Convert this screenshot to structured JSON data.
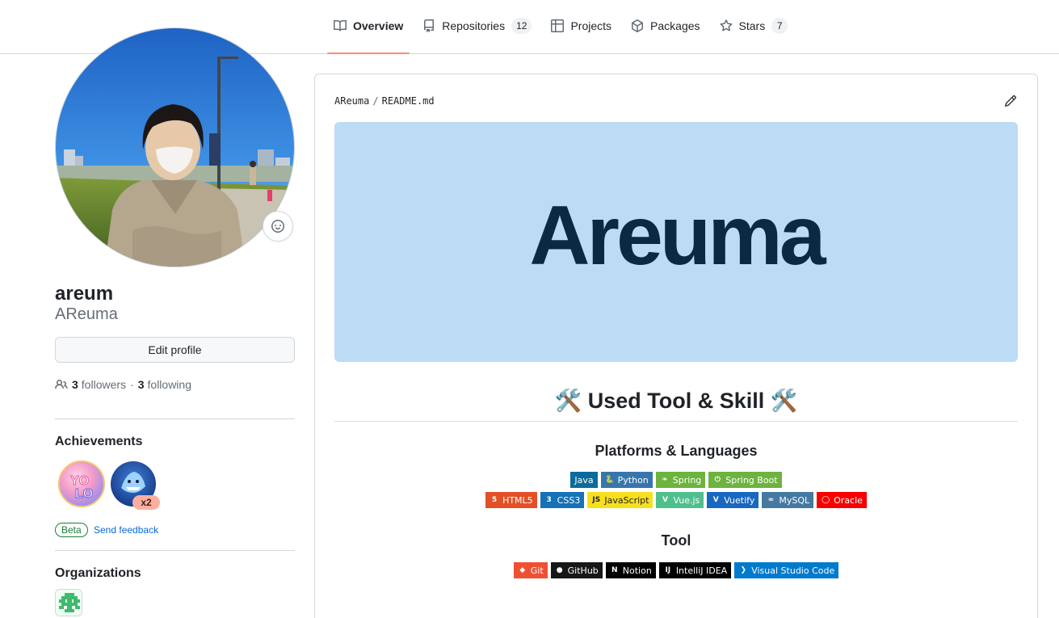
{
  "tabs": [
    {
      "label": "Overview",
      "icon": "book-icon",
      "active": true
    },
    {
      "label": "Repositories",
      "icon": "repo-icon",
      "count": "12"
    },
    {
      "label": "Projects",
      "icon": "table-icon"
    },
    {
      "label": "Packages",
      "icon": "package-icon"
    },
    {
      "label": "Stars",
      "icon": "star-icon",
      "count": "7"
    }
  ],
  "profile": {
    "name": "areum",
    "login": "AReuma",
    "edit_label": "Edit profile",
    "followers_count": "3",
    "followers_label": "followers",
    "following_count": "3",
    "following_label": "following",
    "separator": "·"
  },
  "achievements": {
    "title": "Achievements",
    "items": [
      {
        "icon": "yolo-badge-icon"
      },
      {
        "icon": "pull-shark-badge-icon",
        "count": "x2"
      }
    ],
    "beta_label": "Beta",
    "feedback_label": "Send feedback"
  },
  "organizations": {
    "title": "Organizations"
  },
  "readme": {
    "owner": "AReuma",
    "separator": "/",
    "file": "README.md",
    "banner_text": "Areuma",
    "heading": "🛠️ Used Tool & Skill 🛠️",
    "sections": [
      {
        "title": "Platforms & Languages",
        "rows": [
          [
            {
              "label": "Java",
              "bg": "#0a6c9b",
              "icon": ""
            },
            {
              "label": "Python",
              "bg": "#3776ab",
              "icon": "python"
            },
            {
              "label": "Spring",
              "bg": "#6db33f",
              "icon": "spring"
            },
            {
              "label": "Spring Boot",
              "bg": "#6db33f",
              "icon": "springboot"
            }
          ],
          [
            {
              "label": "HTML5",
              "bg": "#e34f26",
              "icon": "html5"
            },
            {
              "label": "CSS3",
              "bg": "#1572b6",
              "icon": "css3"
            },
            {
              "label": "JavaScript",
              "bg": "#f7df1e",
              "icon": "js",
              "dark": true
            },
            {
              "label": "Vue.js",
              "bg": "#4fc08d",
              "icon": "vue"
            },
            {
              "label": "Vuetify",
              "bg": "#1867c0",
              "icon": "vuetify"
            },
            {
              "label": "MySQL",
              "bg": "#4479a1",
              "icon": "mysql"
            },
            {
              "label": "Oracle",
              "bg": "#f80000",
              "icon": "oracle"
            }
          ]
        ]
      },
      {
        "title": "Tool",
        "rows": [
          [
            {
              "label": "Git",
              "bg": "#f05032",
              "icon": "git"
            },
            {
              "label": "GitHub",
              "bg": "#181717",
              "icon": "github"
            },
            {
              "label": "Notion",
              "bg": "#000000",
              "icon": "notion"
            },
            {
              "label": "IntelliJ IDEA",
              "bg": "#000000",
              "icon": "intellij"
            },
            {
              "label": "Visual Studio Code",
              "bg": "#007acc",
              "icon": "vscode"
            }
          ]
        ]
      }
    ]
  },
  "colors": {
    "accent_underline": "#fd8c73",
    "link": "#0969da",
    "banner_bg": "#bcdcf6",
    "banner_text": "#0b2942"
  }
}
